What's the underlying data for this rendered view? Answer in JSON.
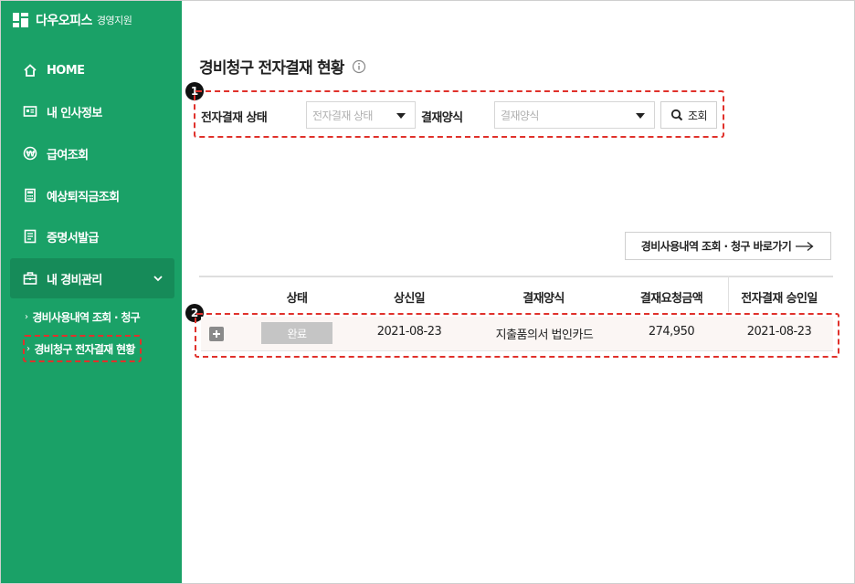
{
  "brand": {
    "name": "다우오피스",
    "sub": "경영지원"
  },
  "nav": [
    {
      "label": "HOME",
      "icon": "home-icon"
    },
    {
      "label": "내 인사정보",
      "icon": "id-card-icon"
    },
    {
      "label": "급여조회",
      "icon": "won-coin-icon"
    },
    {
      "label": "예상퇴직금조회",
      "icon": "calculator-icon"
    },
    {
      "label": "증명서발급",
      "icon": "document-icon"
    },
    {
      "label": "내 경비관리",
      "icon": "briefcase-icon"
    }
  ],
  "sub_nav": [
    {
      "label": "경비사용내역 조회 · 청구"
    },
    {
      "label": "경비청구 전자결재 현황"
    }
  ],
  "page": {
    "title": "경비청구 전자결재 현황"
  },
  "badges": {
    "one": "1",
    "two": "2"
  },
  "filter": {
    "status_label": "전자결재 상태",
    "status_placeholder": "전자결재 상태",
    "form_label": "결재양식",
    "form_placeholder": "결재양식",
    "search_label": "조회"
  },
  "shortcut": {
    "label": "경비사용내역 조회 · 청구 바로가기"
  },
  "table": {
    "headers": [
      "상태",
      "상신일",
      "결재양식",
      "결재요청금액",
      "전자결재 승인일"
    ],
    "rows": [
      {
        "status": "완료",
        "submitted": "2021-08-23",
        "form": "지출품의서 법인카드",
        "amount": "274,950",
        "approved": "2021-08-23"
      }
    ]
  },
  "colors": {
    "sidebar": "#1aa167",
    "sidebar_active": "#168b59",
    "highlight": "#e0312b"
  }
}
